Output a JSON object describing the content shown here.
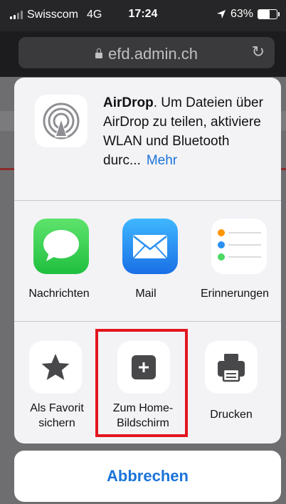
{
  "status_bar": {
    "carrier": "Swisscom",
    "network": "4G",
    "time": "17:24",
    "battery": "63%",
    "battery_level": 0.63
  },
  "browser": {
    "url": "efd.admin.ch"
  },
  "share_sheet": {
    "airdrop": {
      "title": "AirDrop",
      "description": ". Um Dateien über AirDrop zu teilen, aktiviere WLAN und Bluetooth durc...",
      "more_link": "Mehr"
    },
    "apps": [
      {
        "label": "Nachrichten",
        "icon": "messages-icon",
        "color": "#2bd14a"
      },
      {
        "label": "Mail",
        "icon": "mail-icon",
        "color": "#2b8ff2"
      },
      {
        "label": "Erinnerungen",
        "icon": "reminders-icon",
        "color": "#ffffff"
      }
    ],
    "actions": [
      {
        "label": "Als Favorit sichern",
        "icon": "star-icon"
      },
      {
        "label": "Zum Home-Bildschirm",
        "icon": "add-square-icon"
      },
      {
        "label": "Drucken",
        "icon": "printer-icon"
      }
    ],
    "cancel_label": "Abbrechen"
  },
  "colors": {
    "accent": "#1a73d9",
    "highlight_frame": "#e3161d"
  }
}
